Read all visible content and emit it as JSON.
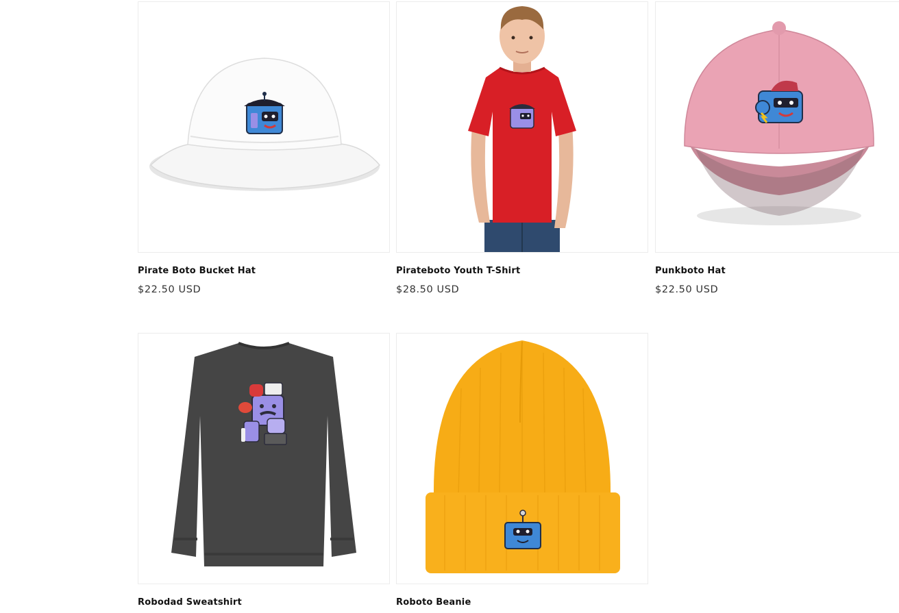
{
  "products": [
    {
      "title": "Pirate Boto Bucket Hat",
      "price": "$22.50 USD",
      "image": "white-bucket-hat-image"
    },
    {
      "title": "Pirateboto Youth T-Shirt",
      "price": "$28.50 USD",
      "image": "red-youth-tshirt-image"
    },
    {
      "title": "Punkboto Hat",
      "price": "$22.50 USD",
      "image": "pink-cap-image"
    },
    {
      "title": "Robodad Sweatshirt",
      "price": "",
      "image": "charcoal-sweatshirt-image"
    },
    {
      "title": "Roboto Beanie",
      "price": "",
      "image": "yellow-beanie-image"
    }
  ],
  "colors": {
    "bucket_hat": "#f7f7f7",
    "tshirt": "#d81f26",
    "cap": "#eaa3b4",
    "sweatshirt": "#444444",
    "beanie": "#f7ac16",
    "robot_blue": "#3f88d6",
    "robot_purple": "#9a8fe6"
  }
}
